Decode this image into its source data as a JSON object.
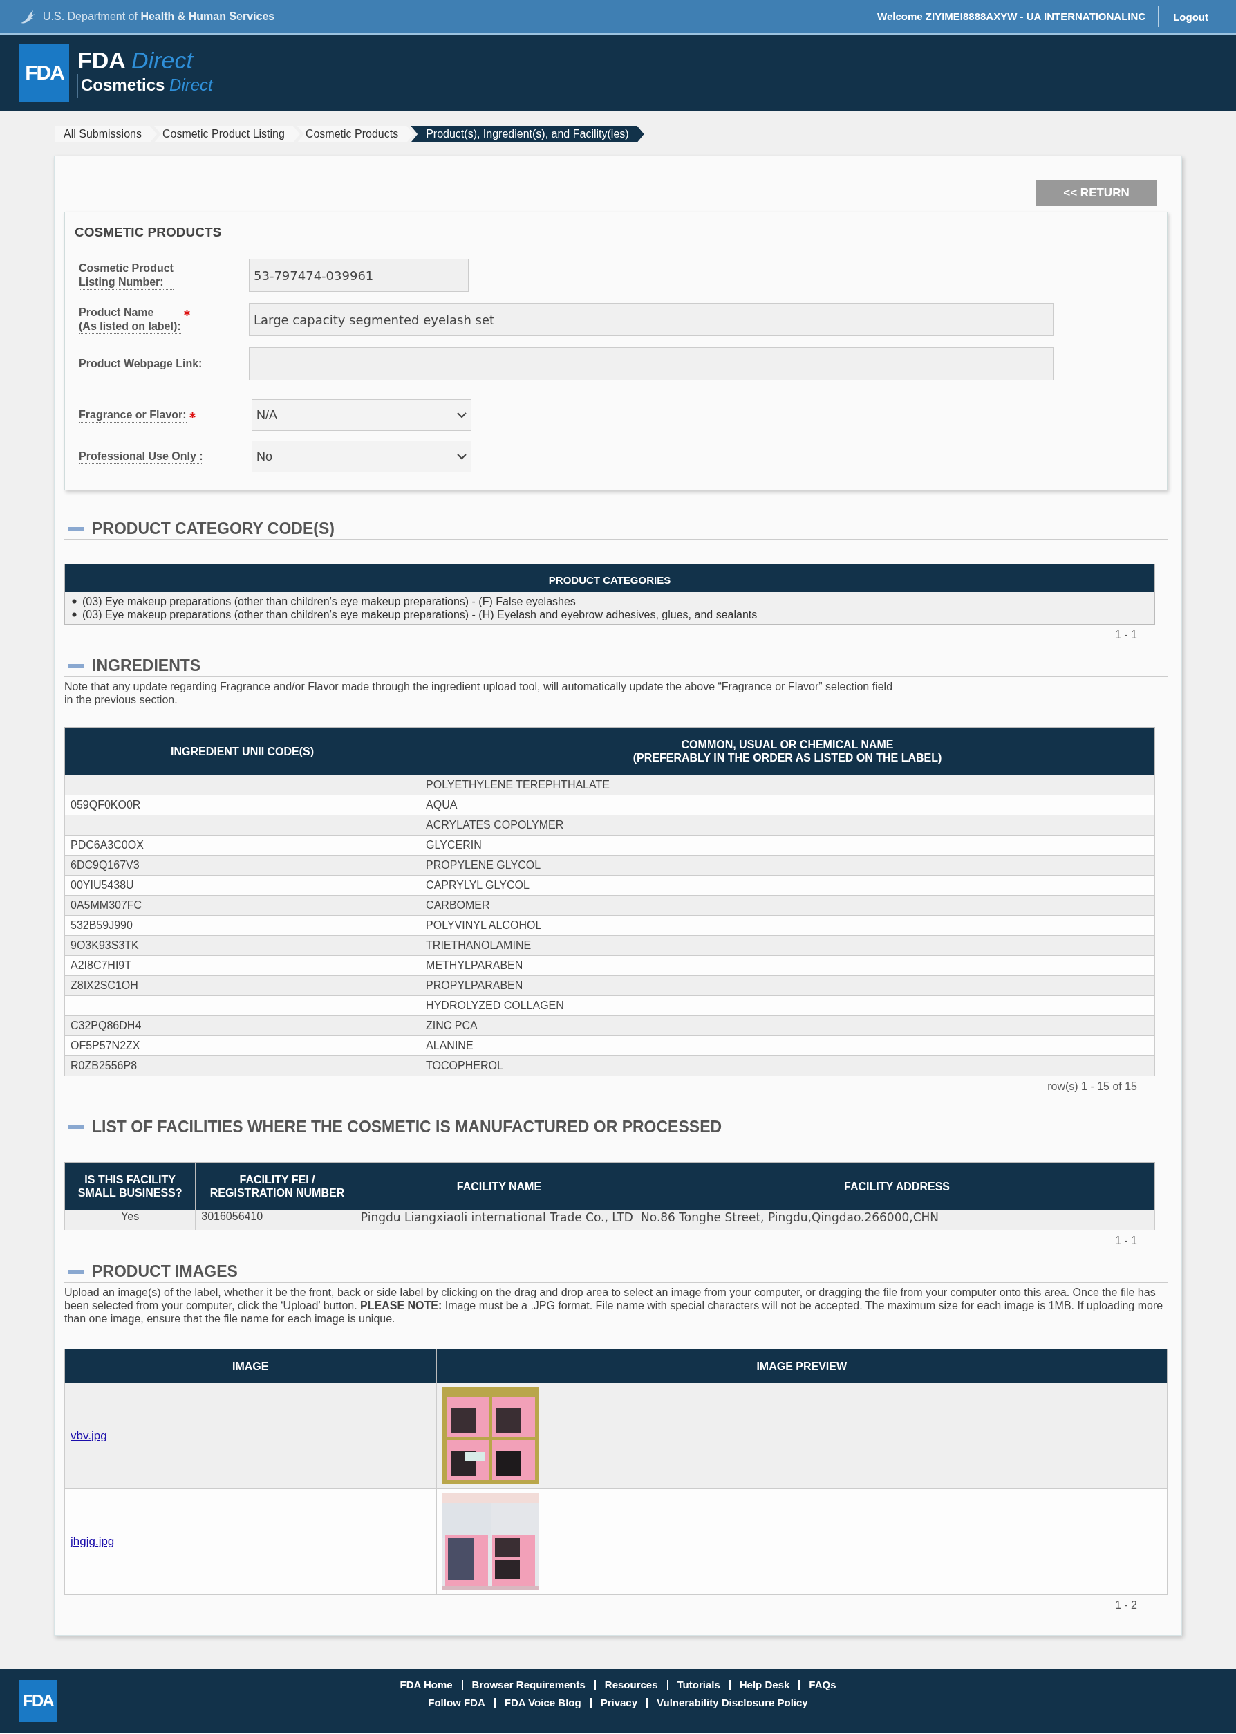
{
  "top_bar": {
    "agency": "U.S. Department of **Health & Human Services**",
    "welcome": "Welcome ZIYIMEI8888AXYW - UA INTERNATIONALINC",
    "logout": "Logout"
  },
  "brand": {
    "logo": "FDA",
    "title": "FDA",
    "title_accent": "Direct",
    "subtitle": "Cosmetics",
    "subtitle_accent": "Direct"
  },
  "breadcrumbs": [
    {
      "label": "All Submissions",
      "selected": false
    },
    {
      "label": "Cosmetic Product Listing",
      "selected": false
    },
    {
      "label": "Cosmetic Products",
      "selected": false
    },
    {
      "label": "Product(s), Ingredient(s), and Facility(ies)",
      "selected": true
    }
  ],
  "return_button": "<< RETURN",
  "cosmetic_products": {
    "title": "COSMETIC PRODUCTS",
    "fields": [
      {
        "kind": "short_text",
        "label": "Cosmetic Product\nListing Number:",
        "value": "53-797474-039961",
        "required": false
      },
      {
        "kind": "text",
        "label": "Product Name\n(As listed on label):",
        "value": "Large capacity segmented eyelash set",
        "required": true
      },
      {
        "kind": "text",
        "label": "Product Webpage Link:",
        "required": false
      },
      {
        "kind": "select",
        "label": "Fragrance or Flavor:",
        "value": "N/A",
        "required": true
      },
      {
        "kind": "select",
        "label": "Professional Use Only :",
        "value": "No",
        "required": false
      }
    ]
  },
  "product_categories": {
    "title": "PRODUCT CATEGORY CODE(S)",
    "header": "PRODUCT CATEGORIES",
    "items": [
      "(03) Eye makeup preparations (other than children’s eye makeup preparations) - (F) False eyelashes",
      "(03) Eye makeup preparations (other than children’s eye makeup preparations) - (H) Eyelash and eyebrow adhesives, glues, and sealants"
    ],
    "pager": "1 - 1"
  },
  "ingredients": {
    "title": "INGREDIENTS",
    "note": "Note that any update regarding Fragrance and/or Flavor made through the ingredient upload tool, will automatically update the above “Fragrance or Flavor” selection field\nin the previous section.",
    "columns": [
      "INGREDIENT UNII CODE(S)",
      "COMMON, USUAL OR CHEMICAL NAME\n(PREFERABLY IN THE ORDER AS LISTED ON THE LABEL)"
    ],
    "rows": [
      {
        "name": "POLYETHYLENE TEREPHTHALATE"
      },
      {
        "code": "059QF0KO0R",
        "name": "AQUA"
      },
      {
        "name": "ACRYLATES COPOLYMER"
      },
      {
        "code": "PDC6A3C0OX",
        "name": "GLYCERIN"
      },
      {
        "code": "6DC9Q167V3",
        "name": "PROPYLENE GLYCOL"
      },
      {
        "code": "00YIU5438U",
        "name": "CAPRYLYL GLYCOL"
      },
      {
        "code": "0A5MM307FC",
        "name": "CARBOMER"
      },
      {
        "code": "532B59J990",
        "name": "POLYVINYL ALCOHOL"
      },
      {
        "code": "9O3K93S3TK",
        "name": "TRIETHANOLAMINE"
      },
      {
        "code": "A2I8C7HI9T",
        "name": "METHYLPARABEN"
      },
      {
        "code": "Z8IX2SC1OH",
        "name": "PROPYLPARABEN"
      },
      {
        "name": "HYDROLYZED COLLAGEN"
      },
      {
        "code": "C32PQ86DH4",
        "name": "ZINC PCA"
      },
      {
        "code": "OF5P57N2ZX",
        "name": "ALANINE"
      },
      {
        "code": "R0ZB2556P8",
        "name": "TOCOPHEROL"
      }
    ],
    "pager": "row(s) 1 - 15 of 15"
  },
  "facilities": {
    "title": "LIST OF FACILITIES WHERE THE COSMETIC IS MANUFACTURED OR PROCESSED",
    "columns": [
      "IS THIS FACILITY\nSMALL BUSINESS?",
      "FACILITY FEI /\nREGISTRATION NUMBER",
      "FACILITY NAME",
      "FACILITY ADDRESS"
    ],
    "rows": [
      {
        "small_business": "Yes",
        "fei": "3016056410",
        "name": "Pingdu Liangxiaoli international Trade Co., LTD",
        "address": "No.86 Tonghe Street, Pingdu,Qingdao.266000,CHN"
      }
    ],
    "pager": "1 - 1"
  },
  "product_images": {
    "title": "PRODUCT IMAGES",
    "note": "Upload an image(s) of the label, whether it be the front, back or side label by clicking on the drag and drop area to select an image from your computer, or dragging the file from your computer onto this area. Once the file has been selected from your computer, click the ‘Upload’ button. **PLEASE NOTE:** Image must be a .JPG format. File name with special characters will not be accepted. The maximum size for each image is 1MB. If uploading more than one image, ensure that the file name for each image is unique.",
    "columns": [
      "IMAGE",
      "IMAGE PREVIEW"
    ],
    "rows": [
      {
        "file": "vbv.jpg"
      },
      {
        "file": "jhgjg.jpg"
      }
    ],
    "pager": "1 - 2"
  },
  "footer": {
    "logo": "FDA",
    "link_rows": [
      [
        "FDA Home",
        "Browser Requirements",
        "Resources",
        "Tutorials",
        "Help Desk",
        "FAQs"
      ],
      [
        "Follow FDA",
        "FDA Voice Blog",
        "Privacy",
        "Vulnerability Disclosure Policy"
      ]
    ]
  }
}
